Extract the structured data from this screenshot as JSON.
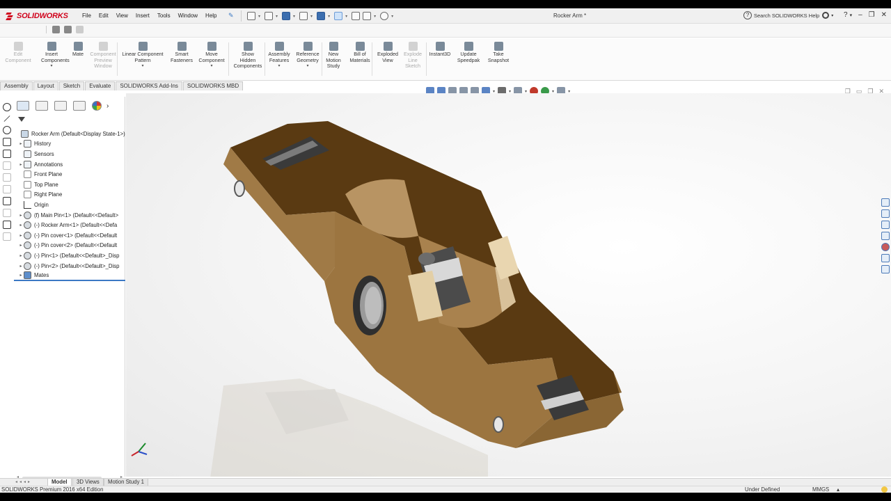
{
  "app": {
    "logo_prefix": "3S",
    "logo_name": "SOLIDWORKS",
    "document_title": "Rocker Arm *",
    "menu": [
      "File",
      "Edit",
      "View",
      "Insert",
      "Tools",
      "Window",
      "Help"
    ],
    "search_placeholder": "Search SOLIDWORKS Help",
    "window_controls": [
      "?",
      "▾",
      "–",
      "❐",
      "✕"
    ]
  },
  "command_manager": {
    "tools": [
      {
        "label": "Edit\nComponent",
        "enabled": false
      },
      {
        "label": "Insert\nComponents",
        "enabled": true,
        "dropdown": true
      },
      {
        "label": "Mate",
        "enabled": true
      },
      {
        "label": "Component\nPreview\nWindow",
        "enabled": false
      },
      {
        "label": "Linear Component\nPattern",
        "enabled": true,
        "dropdown": true
      },
      {
        "label": "Smart\nFasteners",
        "enabled": true
      },
      {
        "label": "Move\nComponent",
        "enabled": true,
        "dropdown": true
      },
      {
        "label": "Show\nHidden\nComponents",
        "enabled": true
      },
      {
        "label": "Assembly\nFeatures",
        "enabled": true,
        "dropdown": true
      },
      {
        "label": "Reference\nGeometry",
        "enabled": true,
        "dropdown": true
      },
      {
        "label": "New\nMotion\nStudy",
        "enabled": true
      },
      {
        "label": "Bill of\nMaterials",
        "enabled": true
      },
      {
        "label": "Exploded\nView",
        "enabled": true
      },
      {
        "label": "Explode\nLine\nSketch",
        "enabled": false
      },
      {
        "label": "Instant3D",
        "enabled": true
      },
      {
        "label": "Update\nSpeedpak",
        "enabled": true
      },
      {
        "label": "Take\nSnapshot",
        "enabled": true
      }
    ]
  },
  "tabs": [
    {
      "label": "Assembly",
      "active": true
    },
    {
      "label": "Layout",
      "active": false
    },
    {
      "label": "Sketch",
      "active": false
    },
    {
      "label": "Evaluate",
      "active": false
    },
    {
      "label": "SOLIDWORKS Add-Ins",
      "active": false
    },
    {
      "label": "SOLIDWORKS MBD",
      "active": false
    }
  ],
  "feature_tree": {
    "root": "Rocker Arm  (Default<Display State-1>)",
    "items": [
      {
        "label": "History",
        "expandable": true,
        "icon": "folder-icon"
      },
      {
        "label": "Sensors",
        "expandable": false,
        "icon": "sensor-icon"
      },
      {
        "label": "Annotations",
        "expandable": true,
        "icon": "annotation-icon"
      },
      {
        "label": "Front Plane",
        "expandable": false,
        "icon": "plane-icon"
      },
      {
        "label": "Top Plane",
        "expandable": false,
        "icon": "plane-icon"
      },
      {
        "label": "Right Plane",
        "expandable": false,
        "icon": "plane-icon"
      },
      {
        "label": "Origin",
        "expandable": false,
        "icon": "origin-icon"
      },
      {
        "label": "(f) Main Pin<1> (Default<<Default>",
        "expandable": true,
        "icon": "part-icon"
      },
      {
        "label": "(-) Rocker Arm<1> (Default<<Defa",
        "expandable": true,
        "icon": "part-icon"
      },
      {
        "label": "(-) Pin cover<1> (Default<<Default",
        "expandable": true,
        "icon": "part-icon"
      },
      {
        "label": "(-) Pin cover<2> (Default<<Default",
        "expandable": true,
        "icon": "part-icon"
      },
      {
        "label": "(-) Pin<1> (Default<<Default>_Disp",
        "expandable": true,
        "icon": "part-icon"
      },
      {
        "label": "(-) Pin<2> (Default<<Default>_Disp",
        "expandable": true,
        "icon": "part-icon"
      },
      {
        "label": "Mates",
        "expandable": true,
        "icon": "mates-icon"
      }
    ]
  },
  "bottom_tabs": [
    {
      "label": "Model",
      "active": true
    },
    {
      "label": "3D Views",
      "active": false
    },
    {
      "label": "Motion Study 1",
      "active": false
    }
  ],
  "status": {
    "edition": "SOLIDWORKS Premium 2016 x64 Edition",
    "state": "Under Defined",
    "units": "MMGS",
    "units_arrow": "▴"
  },
  "colors": {
    "brand_red": "#d0021b",
    "wood_dark": "#5a3a12",
    "wood_light": "#a07a46",
    "selection_blue": "#3b78c4"
  }
}
